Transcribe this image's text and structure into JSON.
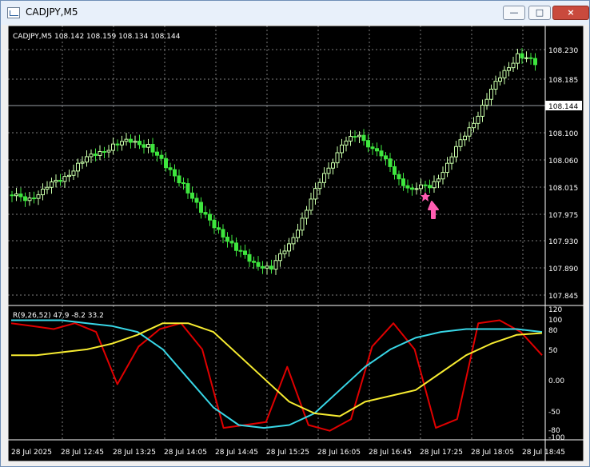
{
  "window": {
    "title": "CADJPY,M5"
  },
  "buttons": {
    "minimize": "—",
    "restore": "□",
    "close": "×"
  },
  "chart": {
    "header": "CADJPY,M5  108.142 108.159 108.134 108.144",
    "current_price": "108.144",
    "price_ticks": [
      "108.230",
      "108.185",
      "108.144",
      "108.100",
      "108.060",
      "108.015",
      "107.975",
      "107.930",
      "107.890",
      "107.845"
    ],
    "time_ticks": [
      "28 Jul 2025",
      "28 Jul 12:45",
      "28 Jul 13:25",
      "28 Jul 14:05",
      "28 Jul 14:45",
      "28 Jul 15:25",
      "28 Jul 16:05",
      "28 Jul 16:45",
      "28 Jul 17:25",
      "28 Jul 18:05",
      "28 Jul 18:45"
    ],
    "indicator_header": "R(9,26,52) 47.9 -8.2 33.2",
    "indicator_ticks": [
      "120",
      "100",
      "80",
      "50",
      "0.00",
      "-50",
      "-80",
      "-100"
    ]
  },
  "chart_data": [
    {
      "type": "candlestick",
      "title": "CADJPY,M5",
      "ohlc_last": {
        "open": 108.142,
        "high": 108.159,
        "low": 108.134,
        "close": 108.144
      },
      "ylim": [
        107.845,
        108.23
      ],
      "x": [
        "28 Jul 2025",
        "28 Jul 12:45",
        "28 Jul 13:25",
        "28 Jul 14:05",
        "28 Jul 14:45",
        "28 Jul 15:25",
        "28 Jul 16:05",
        "28 Jul 16:45",
        "28 Jul 17:25",
        "28 Jul 18:05",
        "28 Jul 18:45"
      ],
      "series": [
        {
          "values": [
            108.0,
            108.01,
            108.03,
            108.05,
            108.07,
            108.08,
            108.09,
            108.08,
            108.05,
            108.02,
            107.98,
            107.95,
            107.92,
            107.9,
            107.89,
            107.93,
            107.98,
            108.04,
            108.08,
            108.1,
            108.07,
            108.04,
            108.01,
            108.02,
            108.05,
            108.1,
            108.14,
            108.19,
            108.22,
            108.21
          ]
        }
      ],
      "annotations": [
        "pink star",
        "pink up-arrow"
      ]
    },
    {
      "type": "line",
      "title": "R(9,26,52) 47.9 -8.2 33.2",
      "ylim": [
        -100,
        120
      ],
      "series": [
        {
          "values": [
            95,
            90,
            85,
            95,
            80,
            -10,
            55,
            85,
            95,
            50,
            -85,
            -80,
            -75,
            20,
            -80,
            -90,
            -70,
            55,
            95,
            50,
            -85,
            -70,
            95,
            100,
            80,
            40
          ]
        },
        {
          "values": [
            100,
            100,
            100,
            95,
            90,
            80,
            50,
            0,
            -50,
            -80,
            -85,
            -80,
            -60,
            -20,
            20,
            50,
            70,
            80,
            85,
            85,
            85,
            80
          ]
        },
        {
          "values": [
            40,
            40,
            45,
            50,
            60,
            75,
            95,
            95,
            80,
            40,
            0,
            -40,
            -60,
            -65,
            -40,
            -30,
            -20,
            10,
            40,
            60,
            75,
            78
          ]
        }
      ]
    }
  ],
  "colors": {
    "bull": "#c9ffaa",
    "bear": "#3ee63e",
    "indicator_red": "#e00000",
    "indicator_cyan": "#38d7e7",
    "indicator_yellow": "#f7ec31",
    "marker": "#ff5db1"
  }
}
